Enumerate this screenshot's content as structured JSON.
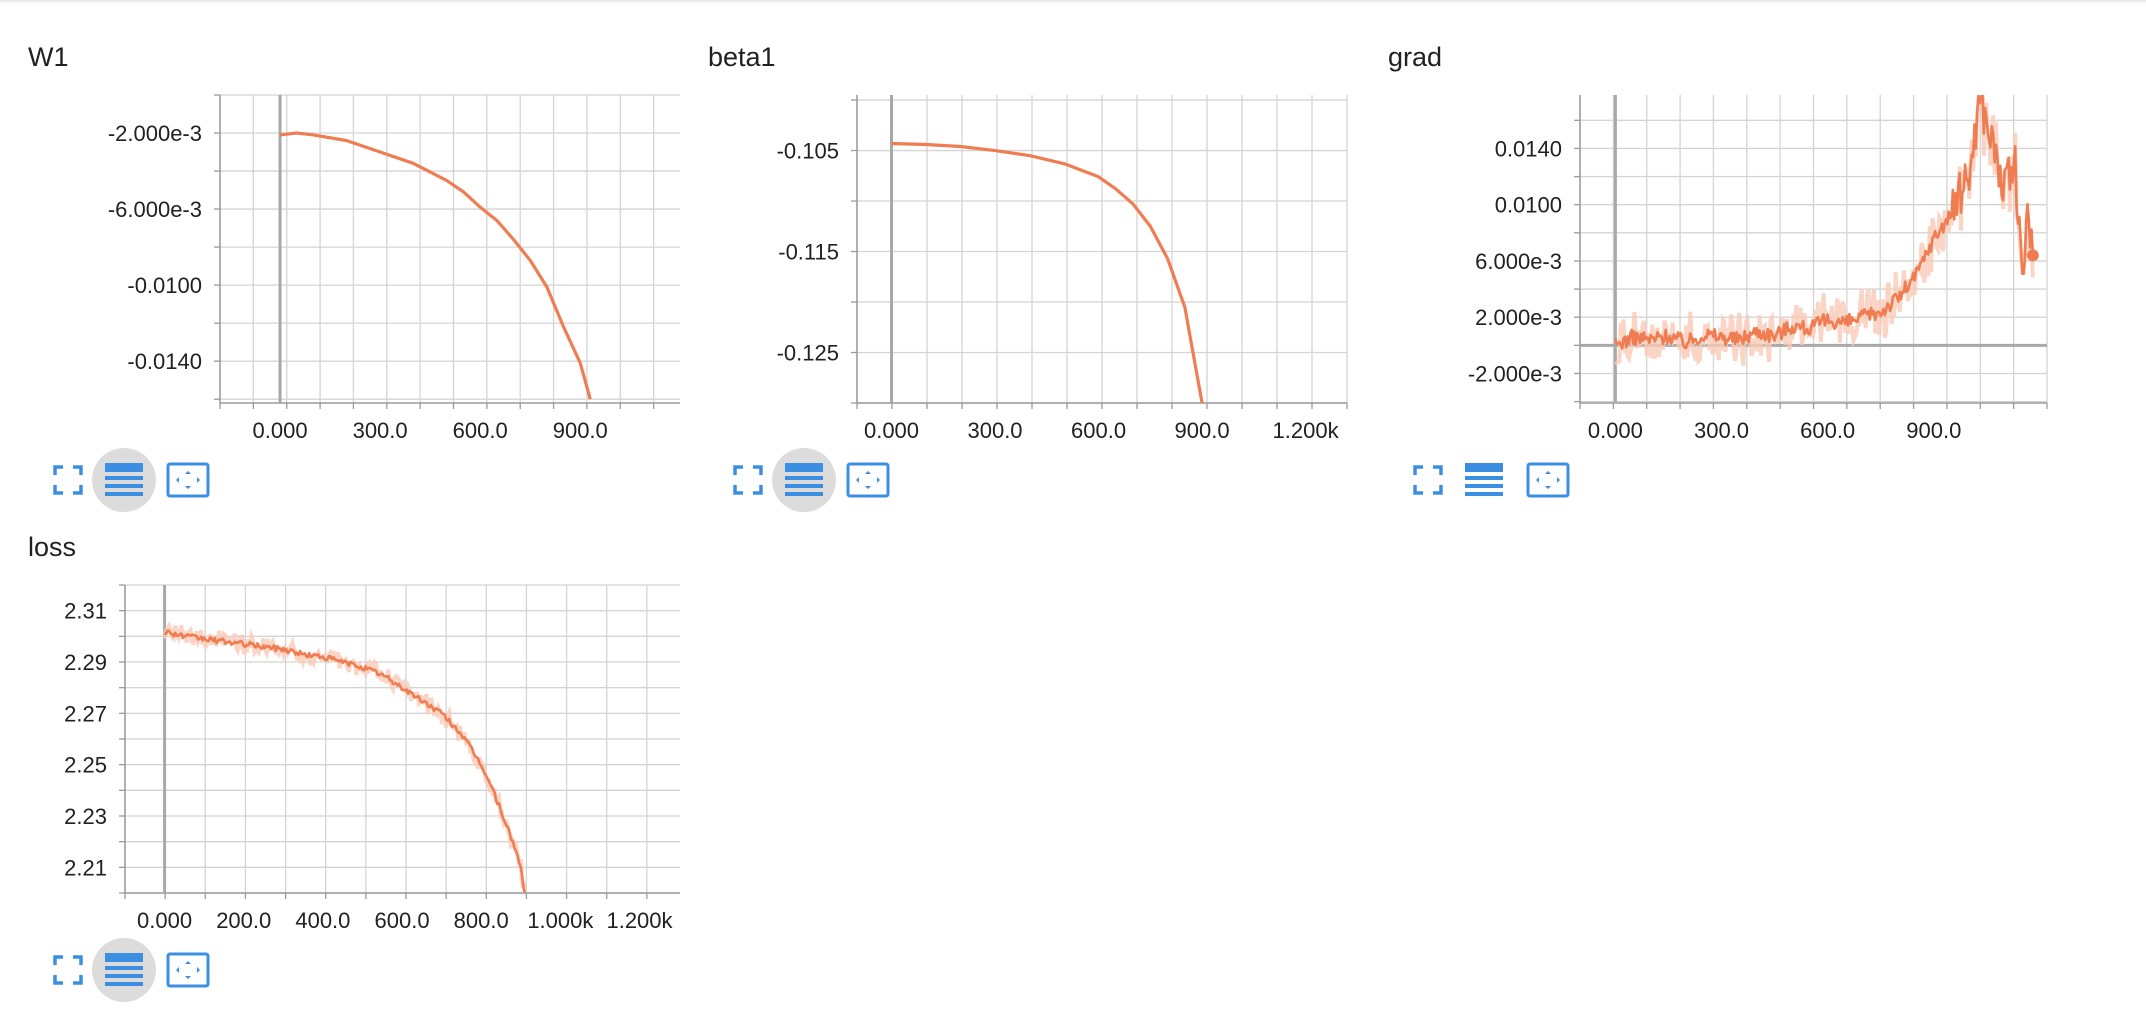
{
  "colors": {
    "series": "#f07d52",
    "series_light": "#f9c9b5",
    "grid": "#d4d4d4",
    "axis": "#9a9a9a",
    "zero_line": "#a8a8a8",
    "icon": "#3b8fe3",
    "active_button_bg": "#dcdcdc"
  },
  "toolbar_icons": {
    "expand": "fullscreen-icon",
    "data": "list-icon",
    "fit": "fit-domain-icon"
  },
  "chart_data": [
    {
      "type": "line",
      "title": "W1",
      "xlim": [
        -180,
        1220
      ],
      "ylim": [
        -0.0162,
        0.0
      ],
      "x_ticks": [
        0,
        300,
        600,
        900
      ],
      "x_tick_labels": [
        "0.000",
        "300.0",
        "600.0",
        "900.0"
      ],
      "y_ticks": [
        -0.002,
        -0.006,
        -0.01,
        -0.014
      ],
      "y_tick_labels": [
        "-2.000e-3",
        "-6.000e-3",
        "-0.0100",
        "-0.0140"
      ],
      "series": [
        {
          "x": [
            0,
            50,
            100,
            200,
            300,
            400,
            500,
            550,
            600,
            650,
            700,
            750,
            800,
            850,
            900,
            930
          ],
          "y": [
            -0.0021,
            -0.002,
            -0.0021,
            -0.0024,
            -0.003,
            -0.0036,
            -0.0045,
            -0.0051,
            -0.0059,
            -0.0066,
            -0.0076,
            -0.0087,
            -0.0101,
            -0.0122,
            -0.0141,
            -0.016
          ]
        }
      ]
    },
    {
      "type": "line",
      "title": "beta1",
      "xlim": [
        -100,
        1320
      ],
      "ylim": [
        -0.13,
        -0.0995
      ],
      "x_ticks": [
        0,
        300,
        600,
        900,
        1200
      ],
      "x_tick_labels": [
        "0.000",
        "300.0",
        "600.0",
        "900.0",
        "1.200k"
      ],
      "y_ticks": [
        -0.105,
        -0.115,
        -0.125
      ],
      "y_tick_labels": [
        "-0.105",
        "-0.115",
        "-0.125"
      ],
      "series": [
        {
          "x": [
            0,
            100,
            200,
            300,
            400,
            500,
            600,
            650,
            700,
            750,
            800,
            850,
            900
          ],
          "y": [
            -0.1043,
            -0.1044,
            -0.1046,
            -0.105,
            -0.1055,
            -0.1063,
            -0.1076,
            -0.1088,
            -0.1103,
            -0.1125,
            -0.1157,
            -0.1205,
            -0.13
          ]
        }
      ]
    },
    {
      "type": "line",
      "title": "grad",
      "xlim": [
        -100,
        1220
      ],
      "ylim": [
        -0.0041,
        0.0178
      ],
      "x_ticks": [
        0,
        300,
        600,
        900
      ],
      "x_tick_labels": [
        "0.000",
        "300.0",
        "600.0",
        "900.0"
      ],
      "y_ticks": [
        -0.002,
        0.002,
        0.006,
        0.01,
        0.014
      ],
      "y_tick_labels": [
        "-2.000e-3",
        "2.000e-3",
        "6.000e-3",
        "0.0100",
        "0.0140"
      ],
      "series": [
        {
          "x": [
            0,
            50,
            100,
            150,
            200,
            250,
            300,
            350,
            400,
            450,
            500,
            550,
            600,
            650,
            700,
            750,
            800,
            850,
            900,
            950,
            1000,
            1030,
            1060,
            1100,
            1130,
            1150,
            1165,
            1180
          ],
          "y": [
            0.0,
            0.0006,
            0.0004,
            0.0007,
            0.0002,
            0.0008,
            0.0006,
            0.0004,
            0.001,
            0.0007,
            0.0014,
            0.0012,
            0.0018,
            0.0016,
            0.002,
            0.0024,
            0.0034,
            0.005,
            0.0076,
            0.0094,
            0.0122,
            0.0176,
            0.015,
            0.011,
            0.013,
            0.004,
            0.01,
            0.0064
          ]
        }
      ]
    },
    {
      "type": "line",
      "title": "loss",
      "xlim": [
        -100,
        1320
      ],
      "ylim": [
        2.2,
        2.32
      ],
      "x_ticks": [
        0,
        200,
        400,
        600,
        800,
        1000,
        1200
      ],
      "x_tick_labels": [
        "0.000",
        "200.0",
        "400.0",
        "600.0",
        "800.0",
        "1.000k",
        "1.200k"
      ],
      "y_ticks": [
        2.31,
        2.29,
        2.27,
        2.25,
        2.23,
        2.21
      ],
      "y_tick_labels": [
        "2.31",
        "2.29",
        "2.27",
        "2.25",
        "2.23",
        "2.21"
      ],
      "series": [
        {
          "x": [
            0,
            50,
            100,
            150,
            200,
            250,
            300,
            350,
            400,
            450,
            500,
            550,
            600,
            650,
            700,
            750,
            800,
            830,
            860,
            880,
            900,
            910
          ],
          "y": [
            2.302,
            2.3,
            2.299,
            2.298,
            2.297,
            2.296,
            2.295,
            2.293,
            2.292,
            2.29,
            2.288,
            2.285,
            2.28,
            2.275,
            2.27,
            2.262,
            2.25,
            2.24,
            2.228,
            2.22,
            2.21,
            2.2
          ]
        }
      ]
    }
  ]
}
